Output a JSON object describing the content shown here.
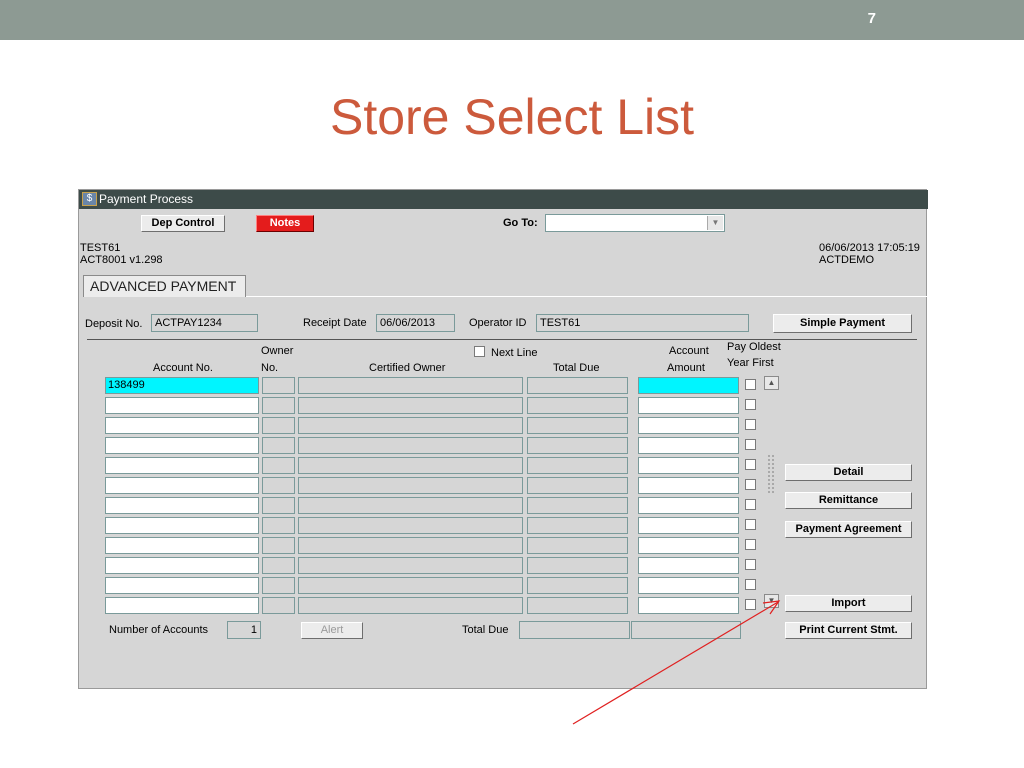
{
  "slide": {
    "number": "7",
    "title": "Store Select List"
  },
  "window": {
    "title": "Payment Process",
    "toolbar": {
      "dep_control": "Dep Control",
      "notes": "Notes",
      "goto_label": "Go To:",
      "goto_value": ""
    },
    "info": {
      "user": "TEST61",
      "version": "ACT8001  v1.298",
      "datetime": "06/06/2013 17:05:19",
      "env": "ACTDEMO"
    },
    "tab": "ADVANCED PAYMENT",
    "deposit": {
      "label": "Deposit No.",
      "value": "ACTPAY1234"
    },
    "receipt": {
      "label": "Receipt Date",
      "value": "06/06/2013"
    },
    "operator": {
      "label": "Operator ID",
      "value": "TEST61"
    },
    "simple_payment": "Simple Payment",
    "columns": {
      "account_no": "Account No.",
      "owner_1": "Owner",
      "owner_2": "No.",
      "certified_owner": "Certified Owner",
      "next_line": "Next Line",
      "total_due": "Total Due",
      "account_amount_1": "Account",
      "account_amount_2": "Amount",
      "pay_oldest_1": "Pay Oldest",
      "pay_oldest_2": "Year First"
    },
    "rows": [
      {
        "account_no": "138499"
      },
      {
        "account_no": ""
      },
      {
        "account_no": ""
      },
      {
        "account_no": ""
      },
      {
        "account_no": ""
      },
      {
        "account_no": ""
      },
      {
        "account_no": ""
      },
      {
        "account_no": ""
      },
      {
        "account_no": ""
      },
      {
        "account_no": ""
      },
      {
        "account_no": ""
      },
      {
        "account_no": ""
      }
    ],
    "side_buttons": {
      "detail": "Detail",
      "remittance": "Remittance",
      "payment_agreement": "Payment Agreement",
      "import": "Import",
      "print": "Print Current Stmt."
    },
    "footer": {
      "num_accounts_label": "Number of Accounts",
      "num_accounts_value": "1",
      "alert": "Alert",
      "total_due_label": "Total Due"
    }
  },
  "colors": {
    "title": "#cc5a3c",
    "accent_cyan": "#00f5ff",
    "notes_red": "#e41c1c",
    "arrow": "#e02020"
  },
  "icons": {
    "window": "app-icon",
    "scroll_up": "arrow-up-icon",
    "scroll_down": "arrow-down-icon",
    "dropdown": "chevron-down-icon"
  }
}
